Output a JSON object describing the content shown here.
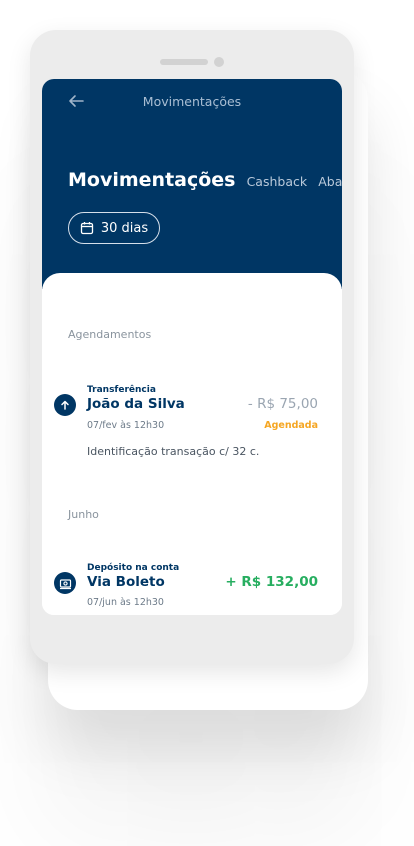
{
  "header": {
    "title": "Movimentações",
    "tabs": [
      "Movimentações",
      "Cashback",
      "Abastec"
    ],
    "period": "30 dias"
  },
  "sections": [
    {
      "label": "Agendamentos",
      "item": {
        "type": "Transferência",
        "name": "João da Silva",
        "date": "07/fev às 12h30",
        "amount": "- R$ 75,00",
        "status": "Agendada",
        "description": "Identificação transação c/ 32 c."
      }
    },
    {
      "label": "Junho",
      "item": {
        "type": "Depósito na conta",
        "name": "Via Boleto",
        "date": "07/jun às 12h30",
        "amount": "+ R$ 132,00"
      }
    }
  ],
  "colors": {
    "primary": "#003664",
    "positive": "#27ae60",
    "warning": "#f5a623",
    "muted": "#9aa5b1"
  },
  "icons": {
    "back": "arrow-left-icon",
    "period": "calendar-icon",
    "transfer": "arrow-up-icon",
    "deposit": "deposit-icon"
  }
}
